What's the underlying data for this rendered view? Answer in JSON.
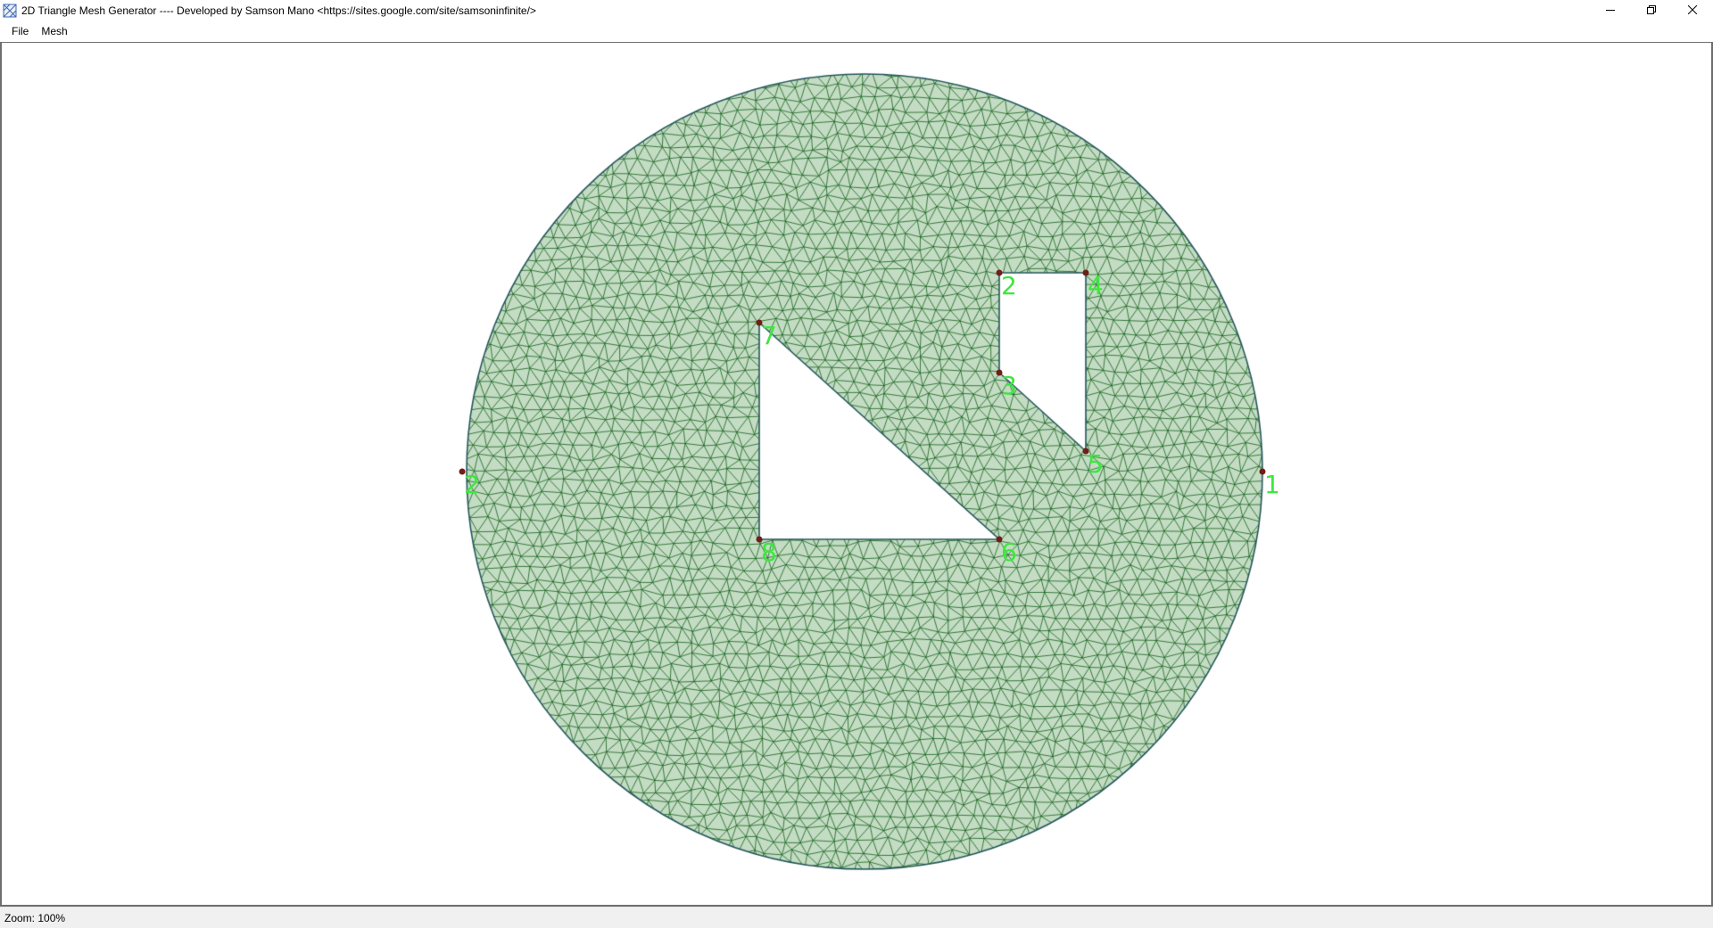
{
  "window": {
    "title": "2D Triangle Mesh Generator ---- Developed by Samson Mano <https://sites.google.com/site/samsoninfinite/>"
  },
  "menu": {
    "items": [
      {
        "label": "File"
      },
      {
        "label": "Mesh"
      }
    ]
  },
  "status": {
    "zoom": "Zoom: 100%"
  },
  "colors": {
    "mesh_fill": "#c3dcc3",
    "mesh_edge": "#17611d",
    "boundary": "#24565c",
    "node_dot": "#6e1f18",
    "node_label": "#3ce83c"
  },
  "icons": {
    "app": "mesh-app-icon",
    "minimize": "minimize-icon",
    "maximize": "restore-icon",
    "close": "close-icon"
  },
  "geometry": {
    "outer_boundary": {
      "shape": "circle",
      "nodes": [
        "1",
        "2"
      ]
    },
    "holes": [
      {
        "nodes": [
          "2",
          "3",
          "5",
          "4"
        ]
      },
      {
        "nodes": [
          "7",
          "8",
          "6"
        ]
      }
    ],
    "nodes": [
      {
        "id": "1",
        "label": "1"
      },
      {
        "id": "2",
        "label": "2"
      },
      {
        "id": "2",
        "label": "2"
      },
      {
        "id": "3",
        "label": "3"
      },
      {
        "id": "4",
        "label": "4"
      },
      {
        "id": "5",
        "label": "5"
      },
      {
        "id": "6",
        "label": "6"
      },
      {
        "id": "7",
        "label": "7"
      },
      {
        "id": "8",
        "label": "8"
      }
    ]
  }
}
